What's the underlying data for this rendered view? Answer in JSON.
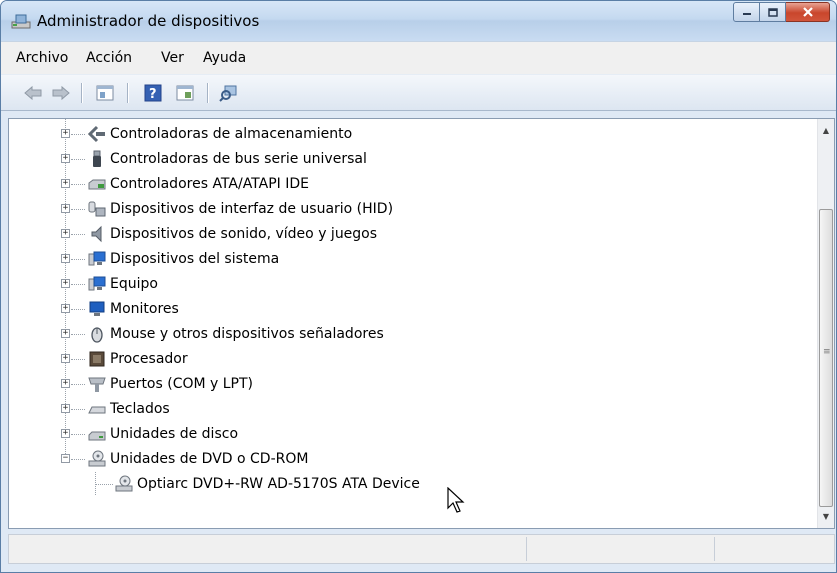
{
  "window": {
    "title": "Administrador de dispositivos",
    "controls": [
      "minimize",
      "maximize",
      "close"
    ]
  },
  "menu": [
    "Archivo",
    "Acción",
    "Ver",
    "Ayuda"
  ],
  "toolbar": {
    "buttons": [
      "back-icon",
      "forward-icon",
      "properties-icon",
      "help-icon",
      "view-icon",
      "scan-hardware-icon"
    ]
  },
  "tree": {
    "nodes": [
      {
        "label": "Controladoras de almacenamiento",
        "icon": "storage-controller-icon",
        "expander": "+"
      },
      {
        "label": "Controladoras de bus serie universal",
        "icon": "usb-icon",
        "expander": "+"
      },
      {
        "label": "Controladores ATA/ATAPI IDE",
        "icon": "ide-controller-icon",
        "expander": "+"
      },
      {
        "label": "Dispositivos de interfaz de usuario (HID)",
        "icon": "hid-icon",
        "expander": "+"
      },
      {
        "label": "Dispositivos de sonido, vídeo y juegos",
        "icon": "speaker-icon",
        "expander": "+"
      },
      {
        "label": "Dispositivos del sistema",
        "icon": "system-devices-icon",
        "expander": "+"
      },
      {
        "label": "Equipo",
        "icon": "computer-icon",
        "expander": "+"
      },
      {
        "label": "Monitores",
        "icon": "monitor-icon",
        "expander": "+"
      },
      {
        "label": "Mouse y otros dispositivos señaladores",
        "icon": "mouse-icon",
        "expander": "+"
      },
      {
        "label": "Procesador",
        "icon": "processor-icon",
        "expander": "+"
      },
      {
        "label": "Puertos (COM y LPT)",
        "icon": "port-icon",
        "expander": "+"
      },
      {
        "label": "Teclados",
        "icon": "keyboard-icon",
        "expander": "+"
      },
      {
        "label": "Unidades de disco",
        "icon": "disk-drive-icon",
        "expander": "+"
      },
      {
        "label": "Unidades de DVD o CD-ROM",
        "icon": "dvd-drive-icon",
        "expander": "−"
      }
    ],
    "child": {
      "label": "Optiarc DVD+-RW AD-5170S ATA Device",
      "icon": "dvd-drive-icon"
    }
  },
  "colors": {
    "titlebar": "#c4d9f0",
    "close_button": "#c9462c",
    "border": "#5a7ea6"
  }
}
